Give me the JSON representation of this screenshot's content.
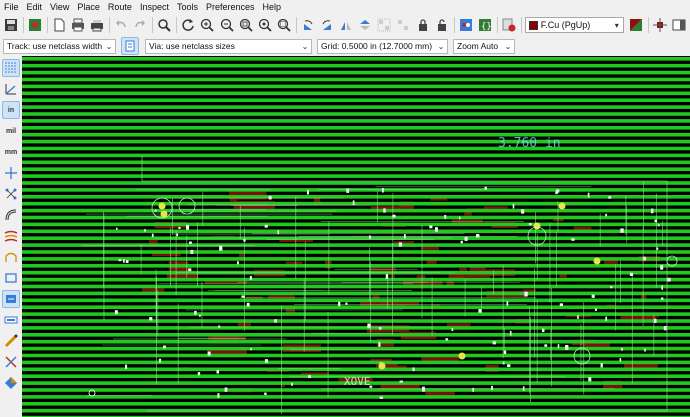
{
  "menu": [
    "File",
    "Edit",
    "View",
    "Place",
    "Route",
    "Inspect",
    "Tools",
    "Preferences",
    "Help"
  ],
  "toolbar": {
    "layer_label": "F.Cu (PgUp)",
    "layer_color": "#8b0000"
  },
  "toolbar2": {
    "track": "Track: use netclass width",
    "via": "Via: use netclass sizes",
    "grid": "Grid: 0.5000 in (12.7000 mm)",
    "zoom": "Zoom Auto"
  },
  "left_toolbar": {
    "units_in": "in",
    "units_mil": "mil",
    "units_mm": "mm"
  },
  "canvas": {
    "dimension_label": "3.760 in",
    "bottom_label": "XOVE",
    "stripe_color": "#1fc91f",
    "copper_color": "#8b1010",
    "background": "#000000"
  }
}
